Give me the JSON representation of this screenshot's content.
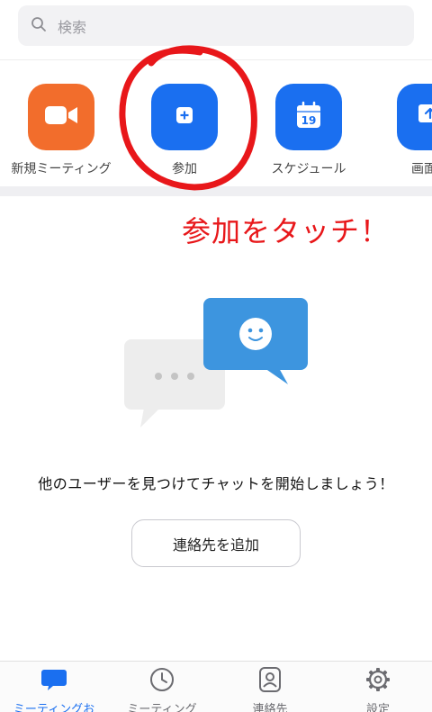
{
  "search": {
    "placeholder": "検索"
  },
  "actions": [
    {
      "label": "新規ミーティング",
      "icon": "video-camera-icon"
    },
    {
      "label": "参加",
      "icon": "plus-icon"
    },
    {
      "label": "スケジュール",
      "icon": "calendar-icon",
      "calendar_day": "19"
    },
    {
      "label": "画面の",
      "icon": "share-screen-icon"
    }
  ],
  "annotation": {
    "text": "参加をタッチ！",
    "color": "#e8171a"
  },
  "empty_state": {
    "message": "他のユーザーを見つけてチャットを開始しましょう！",
    "add_contact_label": "連絡先を追加"
  },
  "tabs": [
    {
      "label": "ミーティングお",
      "icon": "chat-bubble-icon",
      "active": true
    },
    {
      "label": "ミーティング",
      "icon": "clock-icon",
      "active": false
    },
    {
      "label": "連絡先",
      "icon": "contact-icon",
      "active": false
    },
    {
      "label": "設定",
      "icon": "gear-icon",
      "active": false
    }
  ],
  "colors": {
    "accent": "#1a6ff0",
    "orange": "#f26d2c",
    "annotation_red": "#e8171a"
  }
}
